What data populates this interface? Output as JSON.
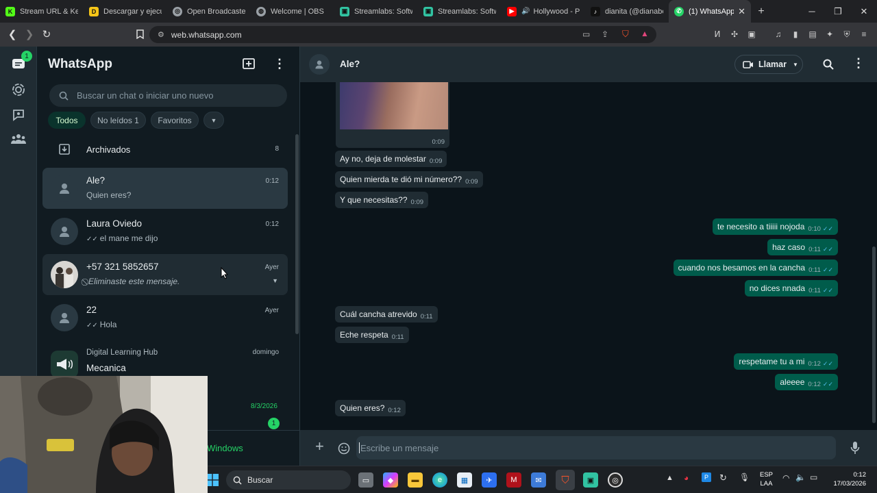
{
  "browser": {
    "tabs": [
      {
        "label": "Stream URL & Key",
        "favicon_color": "#53fc18",
        "favicon_glyph": "K"
      },
      {
        "label": "Descargar y ejecut",
        "favicon_color": "#f5c518",
        "favicon_glyph": "D"
      },
      {
        "label": "Open Broadcaster",
        "favicon_color": "#9aa0a6",
        "favicon_glyph": "◎"
      },
      {
        "label": "Welcome | OBS",
        "favicon_color": "#9aa0a6",
        "favicon_glyph": "◍"
      },
      {
        "label": "Streamlabs: Softw",
        "favicon_color": "#31c3a2",
        "favicon_glyph": "▣"
      },
      {
        "label": "Streamlabs: Softw",
        "favicon_color": "#31c3a2",
        "favicon_glyph": "▣"
      },
      {
        "label": "Hollywood - P",
        "favicon_color": "#ff0000",
        "favicon_glyph": "▶"
      },
      {
        "label": "dianita (@dianabe",
        "favicon_color": "#111111",
        "favicon_glyph": "♪"
      },
      {
        "label": "(1) WhatsApp",
        "favicon_color": "#25d366",
        "favicon_glyph": "✆",
        "active": true
      }
    ],
    "url": "web.whatsapp.com"
  },
  "sidebar": {
    "title": "WhatsApp",
    "chats_badge": "1",
    "search_placeholder": "Buscar un chat o iniciar uno nuevo",
    "filters": {
      "all": "Todos",
      "unread": "No leídos 1",
      "favorites": "Favoritos"
    },
    "archived": {
      "label": "Archivados",
      "count": "8"
    },
    "chats": [
      {
        "name": "Ale?",
        "preview": "Quien eres?",
        "time": "0:12",
        "selected": true
      },
      {
        "name": "Laura Oviedo",
        "preview": "el mane me dijo",
        "time": "0:12",
        "ticks": "✓✓"
      },
      {
        "name": "+57 321 5852657",
        "preview": "Eliminaste este mensaje.",
        "time": "Ayer",
        "deleted_icon": "🚫"
      },
      {
        "name": "22",
        "preview": "Hola",
        "time": "Ayer",
        "ticks": "✓✓"
      },
      {
        "community": "Digital Learning Hub",
        "name": "Mecanica",
        "time": "domingo",
        "preview_tail": "d."
      },
      {
        "time": "8/3/2026",
        "unread": "1",
        "accent": "#25d366"
      }
    ],
    "promo_partial": "Windows"
  },
  "conversation": {
    "contact": "Ale?",
    "call_label": "Llamar",
    "image_time": "0:09",
    "messages": [
      {
        "dir": "in",
        "text": "Ay no, deja de molestar",
        "time": "0:09"
      },
      {
        "dir": "in",
        "text": "Quien mierda te dió mi número??",
        "time": "0:09"
      },
      {
        "dir": "in",
        "text": "Y que necesitas??",
        "time": "0:09"
      },
      {
        "dir": "out",
        "text": "te necesito a tiiiii nojoda",
        "time": "0:10"
      },
      {
        "dir": "out",
        "text": "haz caso",
        "time": "0:11"
      },
      {
        "dir": "out",
        "text": "cuando nos besamos en la cancha",
        "time": "0:11"
      },
      {
        "dir": "out",
        "text": "no dices nnada",
        "time": "0:11"
      },
      {
        "dir": "in",
        "text": "Cuál cancha atrevido",
        "time": "0:11"
      },
      {
        "dir": "in",
        "text": "Eche respeta",
        "time": "0:11"
      },
      {
        "dir": "out",
        "text": "respetame tu a mi",
        "time": "0:12"
      },
      {
        "dir": "out",
        "text": "aleeee",
        "time": "0:12"
      },
      {
        "dir": "in",
        "text": "Quien eres?",
        "time": "0:12"
      }
    ],
    "composer_placeholder": "Escribe un mensaje"
  },
  "taskbar": {
    "search_label": "Buscar",
    "lang": "ESP",
    "lang2": "LAA",
    "time": "0:12",
    "date": "17/03/2026"
  },
  "colors": {
    "accent_green": "#25d366",
    "bubble_out": "#005c4b",
    "bubble_in": "#202c33",
    "panel": "#111b21"
  }
}
